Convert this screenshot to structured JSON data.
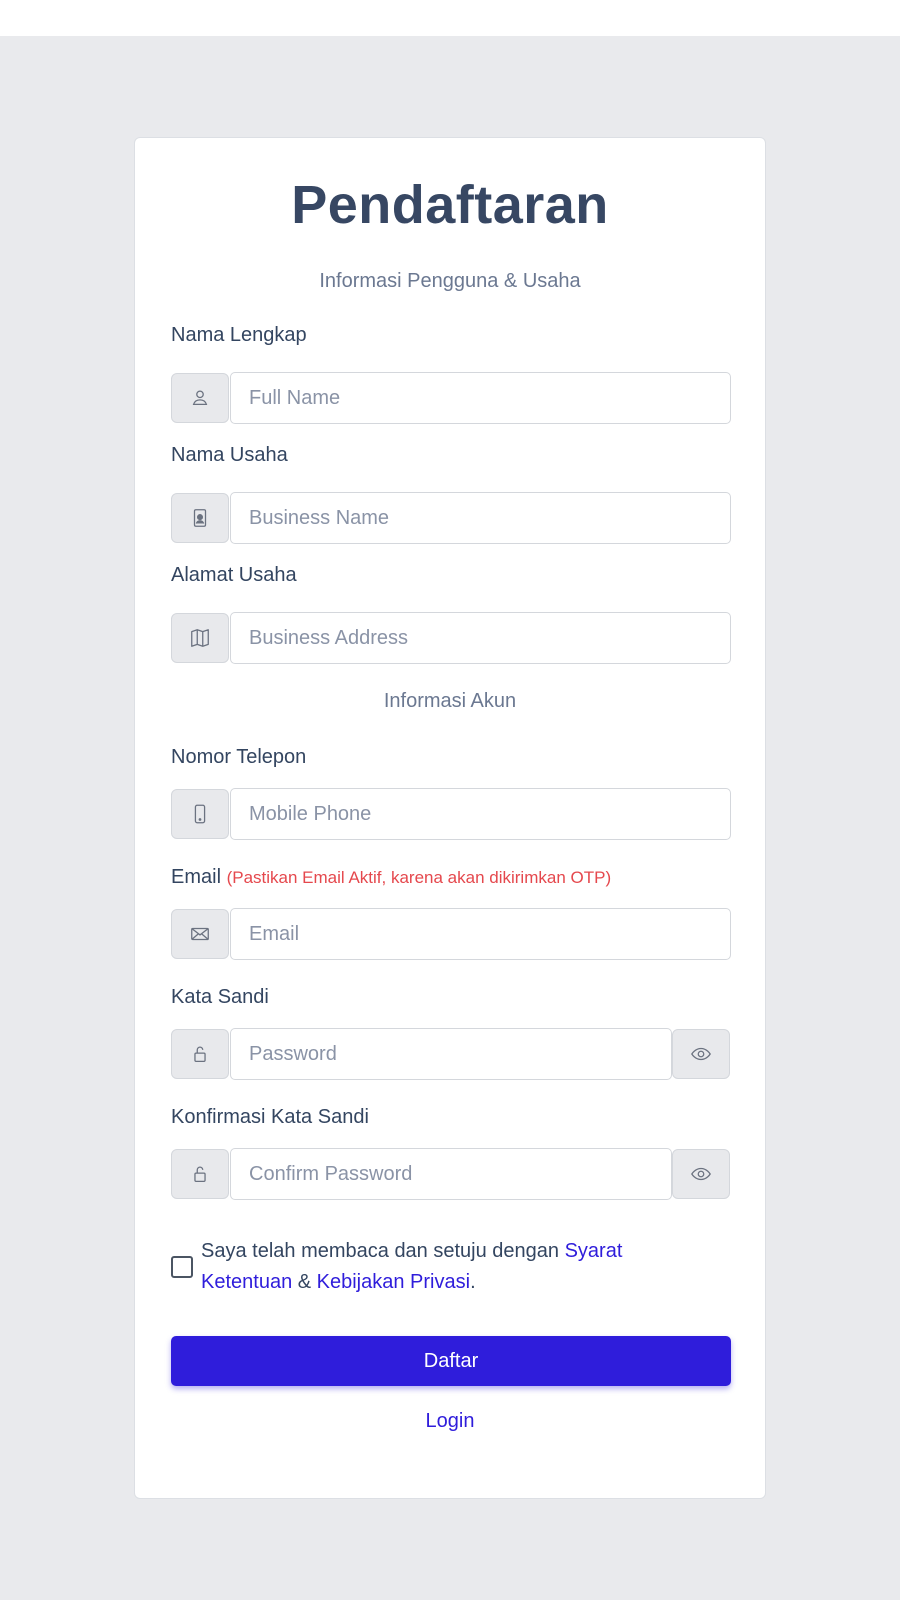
{
  "title": "Pendaftaran",
  "sections": {
    "user_business": "Informasi Pengguna & Usaha",
    "account": "Informasi Akun"
  },
  "fields": {
    "full_name": {
      "label": "Nama Lengkap",
      "placeholder": "Full Name",
      "icon": "user-icon",
      "value": ""
    },
    "business_name": {
      "label": "Nama Usaha",
      "placeholder": "Business Name",
      "icon": "id-badge-icon",
      "value": ""
    },
    "business_address": {
      "label": "Alamat Usaha",
      "placeholder": "Business Address",
      "icon": "map-icon",
      "value": ""
    },
    "phone": {
      "label": "Nomor Telepon",
      "placeholder": "Mobile Phone",
      "icon": "phone-icon",
      "value": ""
    },
    "email": {
      "label": "Email",
      "note": "(Pastikan Email Aktif, karena akan dikirimkan OTP)",
      "placeholder": "Email",
      "icon": "envelope-icon",
      "value": ""
    },
    "password": {
      "label": "Kata Sandi",
      "placeholder": "Password",
      "icon": "lock-icon",
      "toggle_icon": "eye-icon",
      "value": ""
    },
    "confirm_password": {
      "label": "Konfirmasi Kata Sandi",
      "placeholder": "Confirm Password",
      "icon": "lock-icon",
      "toggle_icon": "eye-icon",
      "value": ""
    }
  },
  "agreement": {
    "checked": false,
    "text_before": "Saya telah membaca dan setuju dengan ",
    "terms_link": "Syarat Ketentuan",
    "joiner": " & ",
    "privacy_link": "Kebijakan Privasi",
    "text_after": "."
  },
  "submit_label": "Daftar",
  "login_link": "Login",
  "colors": {
    "primary": "#2f1ddb",
    "warning_note": "#e5484d",
    "title": "#374763",
    "page_background": "#e9eaed"
  }
}
